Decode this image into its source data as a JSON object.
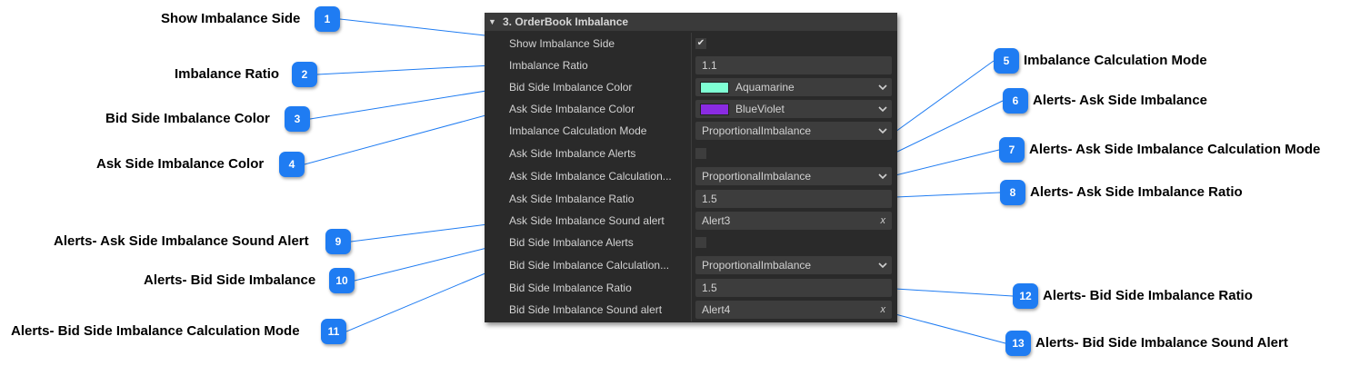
{
  "panel": {
    "title": "3. OrderBook Imbalance",
    "rows": [
      {
        "label": "Show Imbalance Side",
        "kind": "check",
        "checked": true
      },
      {
        "label": "Imbalance Ratio",
        "kind": "text",
        "value": "1.1"
      },
      {
        "label": "Bid Side Imbalance Color",
        "kind": "color",
        "value": "Aquamarine",
        "color": "#7fffd4"
      },
      {
        "label": "Ask Side Imbalance Color",
        "kind": "color",
        "value": "BlueViolet",
        "color": "#8a2be2"
      },
      {
        "label": "Imbalance Calculation Mode",
        "kind": "select",
        "value": "ProportionalImbalance"
      },
      {
        "label": "Ask Side Imbalance Alerts",
        "kind": "check",
        "checked": false
      },
      {
        "label": "Ask Side Imbalance Calculation...",
        "kind": "select",
        "value": "ProportionalImbalance"
      },
      {
        "label": "Ask Side Imbalance Ratio",
        "kind": "text",
        "value": "1.5"
      },
      {
        "label": "Ask Side Imbalance Sound alert",
        "kind": "file",
        "value": "Alert3",
        "clear": "x"
      },
      {
        "label": "Bid Side Imbalance Alerts",
        "kind": "check",
        "checked": false
      },
      {
        "label": "Bid Side Imbalance Calculation...",
        "kind": "select",
        "value": "ProportionalImbalance"
      },
      {
        "label": "Bid Side Imbalance Ratio",
        "kind": "text",
        "value": "1.5"
      },
      {
        "label": "Bid Side Imbalance Sound alert",
        "kind": "file",
        "value": "Alert4",
        "clear": "x"
      }
    ]
  },
  "callouts": [
    {
      "num": "1",
      "text": "Show Imbalance Side",
      "side": "left",
      "row": 0
    },
    {
      "num": "2",
      "text": "Imbalance Ratio",
      "side": "left",
      "row": 1
    },
    {
      "num": "3",
      "text": "Bid Side Imbalance Color",
      "side": "left",
      "row": 2
    },
    {
      "num": "4",
      "text": "Ask Side Imbalance Color",
      "side": "left",
      "row": 3
    },
    {
      "num": "5",
      "text": "Imbalance Calculation Mode",
      "side": "right",
      "row": 4
    },
    {
      "num": "6",
      "text": "Alerts- Ask Side Imbalance",
      "side": "right",
      "row": 5
    },
    {
      "num": "7",
      "text": "Alerts- Ask Side Imbalance Calculation Mode",
      "side": "right",
      "row": 6
    },
    {
      "num": "8",
      "text": "Alerts- Ask Side Imbalance Ratio",
      "side": "right",
      "row": 7
    },
    {
      "num": "9",
      "text": "Alerts- Ask Side Imbalance Sound Alert",
      "side": "left",
      "row": 8
    },
    {
      "num": "10",
      "text": "Alerts- Bid Side Imbalance",
      "side": "left",
      "row": 9
    },
    {
      "num": "11",
      "text": "Alerts- Bid Side Imbalance Calculation Mode",
      "side": "left",
      "row": 10
    },
    {
      "num": "12",
      "text": "Alerts- Bid Side Imbalance Ratio",
      "side": "right",
      "row": 11
    },
    {
      "num": "13",
      "text": "Alerts- Bid Side Imbalance Sound Alert",
      "side": "right",
      "row": 12
    }
  ],
  "colors": {
    "badge": "#1f7cf2",
    "line": "#1f7cf2",
    "panel_bg": "#2a2a2a"
  }
}
